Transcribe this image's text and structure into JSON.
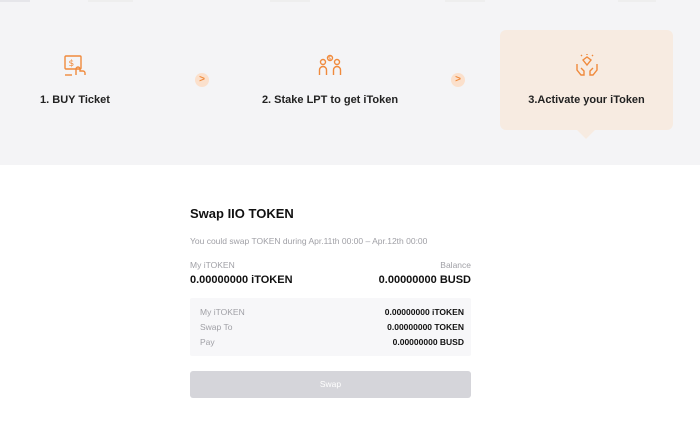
{
  "steps": [
    {
      "label": "1. BUY Ticket",
      "icon": "ticket-hand-icon"
    },
    {
      "label": "2. Stake LPT to get iToken",
      "icon": "stake-people-icon"
    },
    {
      "label": "3.Activate your iToken",
      "icon": "activate-hands-icon"
    }
  ],
  "step_arrow": ">",
  "swap": {
    "title": "Swap IIO TOKEN",
    "hint": "You could swap TOKEN during  Apr.11th 00:00 – Apr.12th 00:00",
    "my_itoken_label": "My iTOKEN",
    "my_itoken_value": "0.00000000 iTOKEN",
    "balance_label": "Balance",
    "balance_value": "0.00000000 BUSD",
    "summary": [
      {
        "label": "My iTOKEN",
        "value": "0.00000000 iTOKEN"
      },
      {
        "label": "Swap To",
        "value": "0.00000000 TOKEN"
      },
      {
        "label": "Pay",
        "value": "0.00000000 BUSD"
      }
    ],
    "button_label": "Swap"
  },
  "colors": {
    "accent": "#f08a3c",
    "active_step_bg": "#f7ebe1",
    "button_disabled": "#d5d5da"
  }
}
